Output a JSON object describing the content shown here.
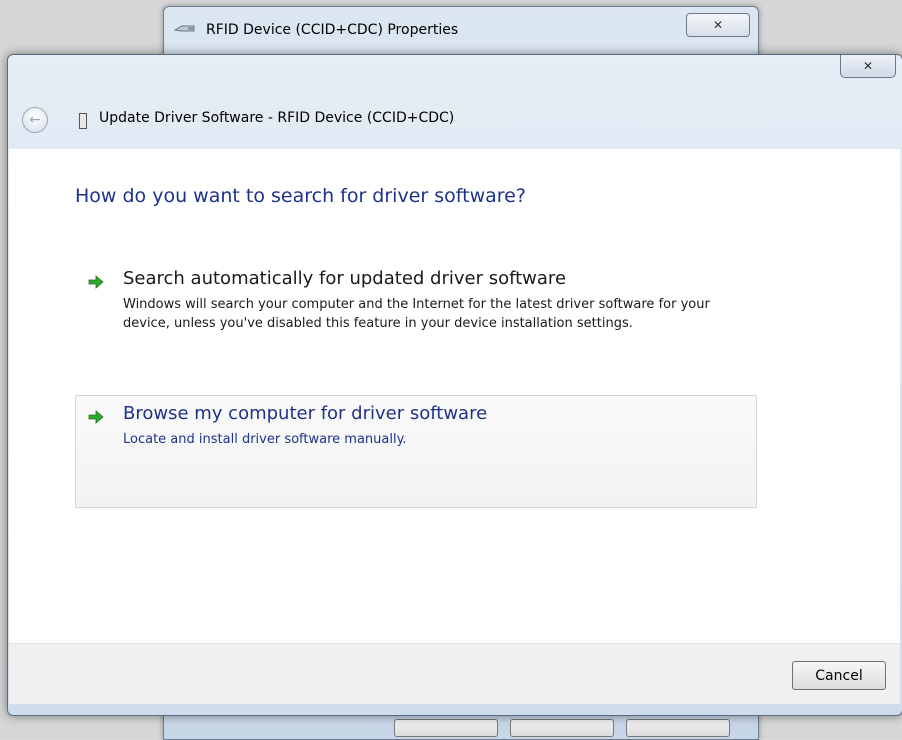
{
  "background_window": {
    "title": "RFID Device (CCID+CDC) Properties",
    "close_glyph": "✕",
    "icon": "usb-device-icon"
  },
  "dialog": {
    "close_glyph": "✕",
    "back_glyph": "←",
    "title": "Update Driver Software - RFID Device (CCID+CDC)",
    "heading": "How do you want to search for driver software?",
    "options": [
      {
        "title": "Search automatically for updated driver software",
        "description": "Windows will search your computer and the Internet for the latest driver software for your device, unless you've disabled this feature in your device installation settings.",
        "icon": "green-arrow-icon"
      },
      {
        "title": "Browse my computer for driver software",
        "description": "Locate and install driver software manually.",
        "icon": "green-arrow-icon"
      }
    ],
    "cancel_label": "Cancel"
  },
  "colors": {
    "heading": "#1e3287",
    "arrow": "#2ea82e",
    "content_bg": "#ffffff",
    "footer_bg": "#f0f0f0"
  }
}
